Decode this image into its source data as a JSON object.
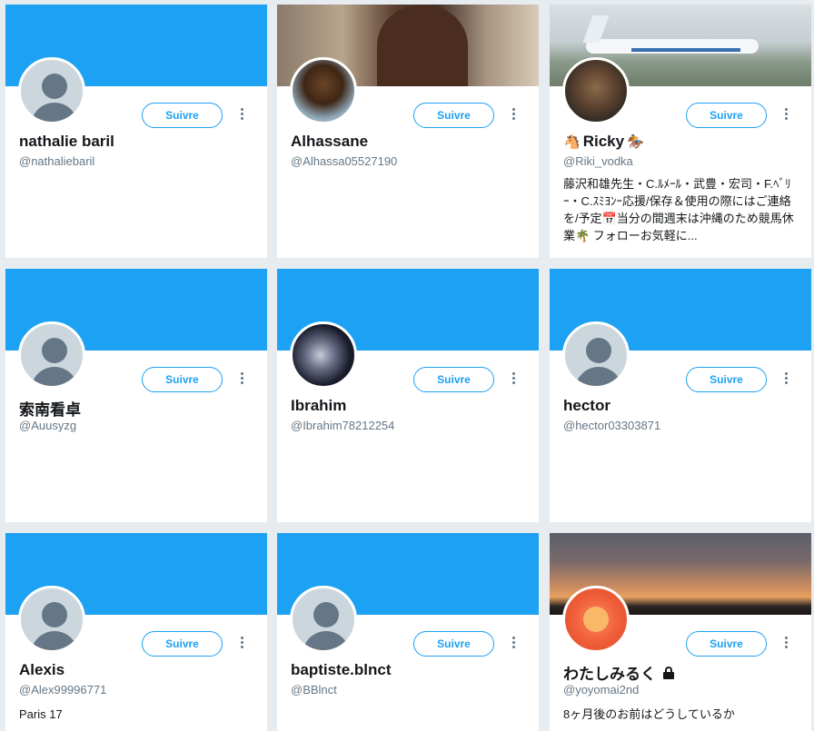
{
  "follow_label": "Suivre",
  "cards": [
    {
      "name": "nathalie baril",
      "handle": "@nathaliebaril",
      "bio": ""
    },
    {
      "name": "Alhassane",
      "handle": "@Alhassa05527190",
      "bio": ""
    },
    {
      "name_prefix": "🐴",
      "name": "Ricky",
      "name_suffix": "🏇",
      "handle": "@Riki_vodka",
      "bio": "藤沢和雄先生・C.ﾙﾒｰﾙ・武豊・宏司・F.ﾍﾞﾘｰ・C.ｽﾐﾖﾝｰ応援/保存＆使用の際にはご連絡を/予定📅当分の間週末は沖縄のため競馬休業🌴 フォローお気軽に..."
    },
    {
      "name": "索南看卓",
      "handle": "@Auusyzg",
      "bio": ""
    },
    {
      "name": "Ibrahim",
      "handle": "@Ibrahim78212254",
      "bio": ""
    },
    {
      "name": "hector",
      "handle": "@hector03303871",
      "bio": ""
    },
    {
      "name": "Alexis",
      "handle": "@Alex99996771",
      "bio": "Paris 17"
    },
    {
      "name": "baptiste.blnct",
      "handle": "@BBlnct",
      "bio": ""
    },
    {
      "name": "わたしみるく",
      "handle": "@yoyomai2nd",
      "bio": "8ヶ月後のお前はどうしているか",
      "protected": true
    }
  ],
  "colors": {
    "accent": "#1da1f2",
    "secondary_text": "#657786",
    "default_avatar_bg": "#ccd6dd"
  }
}
